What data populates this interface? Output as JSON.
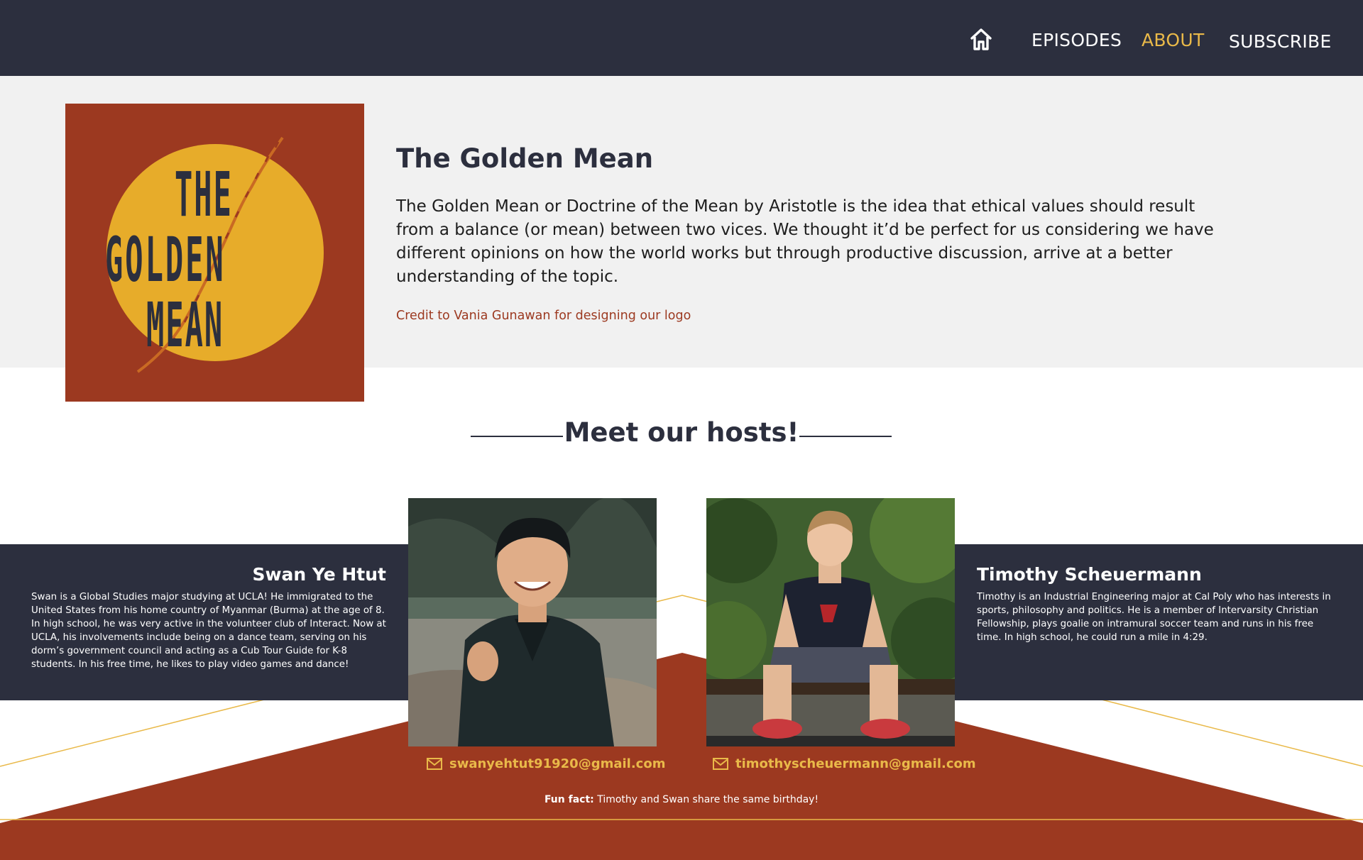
{
  "nav": {
    "home_icon": "home-icon",
    "items": [
      {
        "label": "EPISODES",
        "active": false
      },
      {
        "label": "ABOUT",
        "active": true
      },
      {
        "label": "SUBSCRIBE",
        "active": false
      }
    ],
    "active_color": "#e9b949"
  },
  "intro": {
    "logo": {
      "line1": "THE",
      "line2": "GOLDEN",
      "line3": "MEAN"
    },
    "title": "The Golden Mean",
    "description": "The Golden Mean or Doctrine of the Mean by Aristotle is the idea that ethical values should result from a balance (or mean) between two vices. We thought it’d be perfect for us considering we have different opinions on how the world works but through productive discussion, arrive at a better understanding of the topic.",
    "credit": "Credit to Vania Gunawan for designing our logo"
  },
  "hosts": {
    "heading": "Meet our hosts!",
    "people": [
      {
        "name": "Swan Ye Htut",
        "bio": "Swan is a Global Studies major studying at UCLA! He immigrated to the United States from his home country of Myanmar (Burma) at the age of 8. In high school, he was very active in the volunteer club of Interact. Now at UCLA, his involvements include being on a dance team, serving on his dorm’s government council and acting as a Cub Tour Guide for K-8 students. In his free time, he likes to play video games and dance!",
        "email": "swanyehtut91920@gmail.com",
        "email_icon": "mail-icon"
      },
      {
        "name": "Timothy Scheuermann",
        "bio": "Timothy is an Industrial Engineering major at Cal Poly who has interests in sports, philosophy and politics. He is a member of Intervarsity Christian Fellowship, plays goalie on intramural soccer team and runs in his free time. In high school, he could run a mile in 4:29.",
        "email": "timothyscheuermann@gmail.com",
        "email_icon": "mail-icon"
      }
    ],
    "fun_fact_label": "Fun fact:",
    "fun_fact_text": " Timothy and Swan share the same birthday!"
  },
  "colors": {
    "navy": "#2c2f3e",
    "rust": "#9c3920",
    "gold": "#e9b949",
    "light_gray": "#f1f1f1"
  }
}
